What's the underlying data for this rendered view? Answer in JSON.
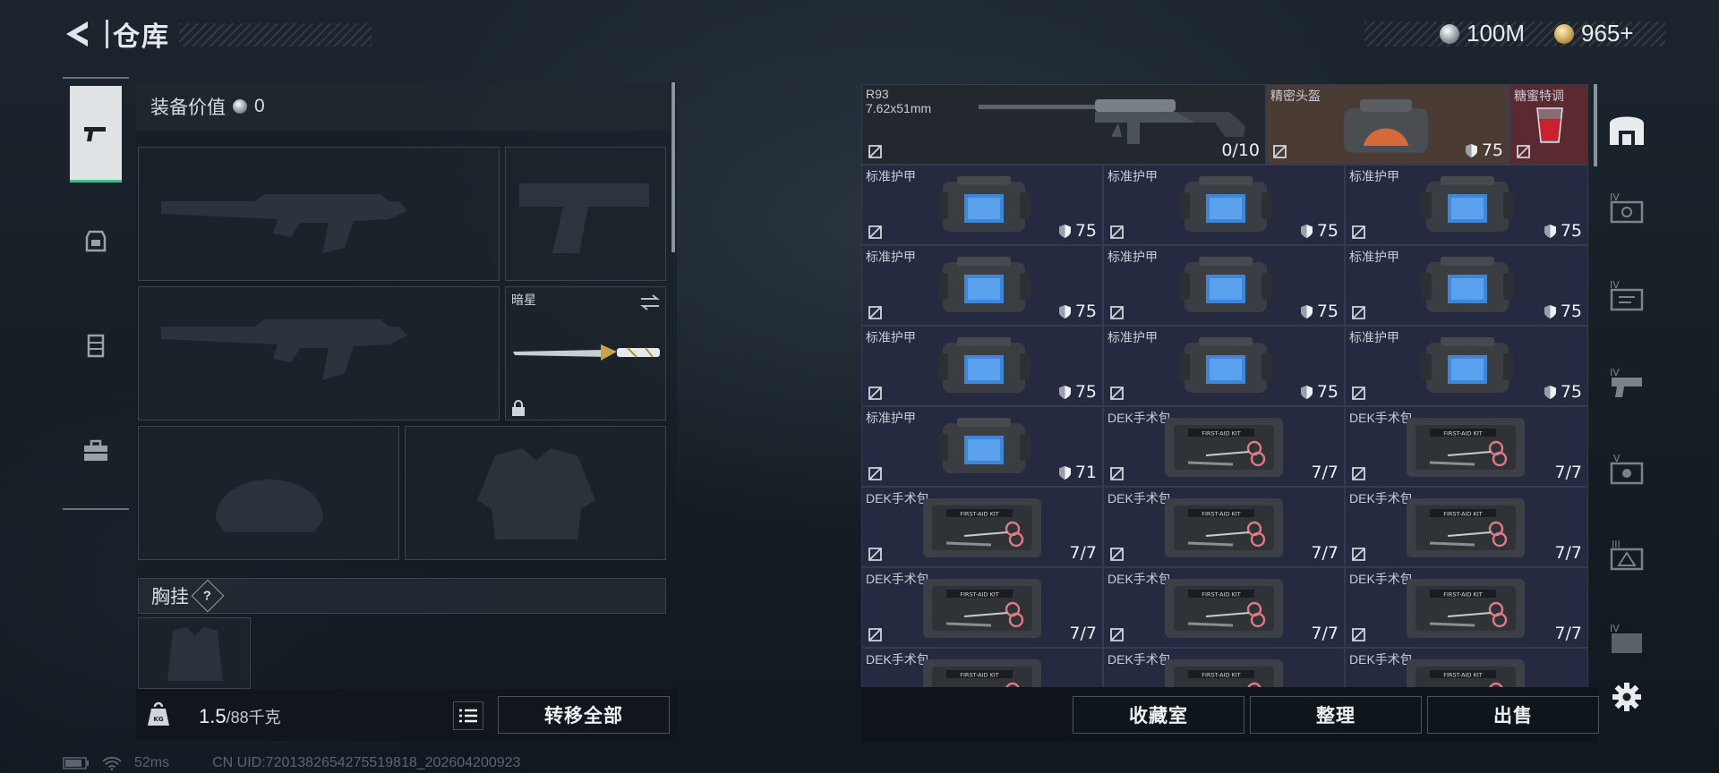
{
  "header": {
    "title": "仓库"
  },
  "currency": {
    "silver": "100M",
    "gold": "965+"
  },
  "left_panel": {
    "equip_value_label": "装备价值",
    "equip_value": "0",
    "melee_name": "暗星",
    "chest_rig_label": "胸挂",
    "chest_rig_help": "?",
    "weight_current": "1.5",
    "weight_max": "/88千克",
    "transfer_all": "转移全部"
  },
  "storage": {
    "row0": [
      {
        "name": "R93",
        "sub": "7.62x51mm",
        "value": "0/10"
      },
      {
        "name": "精密头盔",
        "value": "75"
      },
      {
        "name": "糖蜜特调"
      }
    ],
    "items": [
      {
        "name": "标准护甲",
        "value": "75",
        "kind": "armor"
      },
      {
        "name": "标准护甲",
        "value": "75",
        "kind": "armor"
      },
      {
        "name": "标准护甲",
        "value": "75",
        "kind": "armor"
      },
      {
        "name": "标准护甲",
        "value": "75",
        "kind": "armor"
      },
      {
        "name": "标准护甲",
        "value": "75",
        "kind": "armor"
      },
      {
        "name": "标准护甲",
        "value": "75",
        "kind": "armor"
      },
      {
        "name": "标准护甲",
        "value": "75",
        "kind": "armor"
      },
      {
        "name": "标准护甲",
        "value": "75",
        "kind": "armor"
      },
      {
        "name": "标准护甲",
        "value": "75",
        "kind": "armor"
      },
      {
        "name": "标准护甲",
        "value": "71",
        "kind": "armor"
      },
      {
        "name": "DEK手术包",
        "value": "7/7",
        "kind": "kit"
      },
      {
        "name": "DEK手术包",
        "value": "7/7",
        "kind": "kit"
      },
      {
        "name": "DEK手术包",
        "value": "7/7",
        "kind": "kit"
      },
      {
        "name": "DEK手术包",
        "value": "7/7",
        "kind": "kit"
      },
      {
        "name": "DEK手术包",
        "value": "7/7",
        "kind": "kit"
      },
      {
        "name": "DEK手术包",
        "value": "7/7",
        "kind": "kit"
      },
      {
        "name": "DEK手术包",
        "value": "7/7",
        "kind": "kit"
      },
      {
        "name": "DEK手术包",
        "value": "7/7",
        "kind": "kit"
      },
      {
        "name": "DEK手术包",
        "value": "",
        "kind": "kit"
      },
      {
        "name": "DEK手术包",
        "value": "",
        "kind": "kit"
      },
      {
        "name": "DEK手术包",
        "value": "",
        "kind": "kit"
      }
    ],
    "kit_label": "FIRST-AID KIT",
    "buttons": {
      "collection": "收藏室",
      "sort": "整理",
      "sell": "出售"
    }
  },
  "status": {
    "ping": "52ms",
    "uid": "CN UID:7201382654275519818_202604200923"
  },
  "colors": {
    "accent_green": "#3fbf86",
    "cell_bg": "#252a40",
    "rare_bg": "#4a3c34",
    "red_bg": "#5a2a30"
  }
}
